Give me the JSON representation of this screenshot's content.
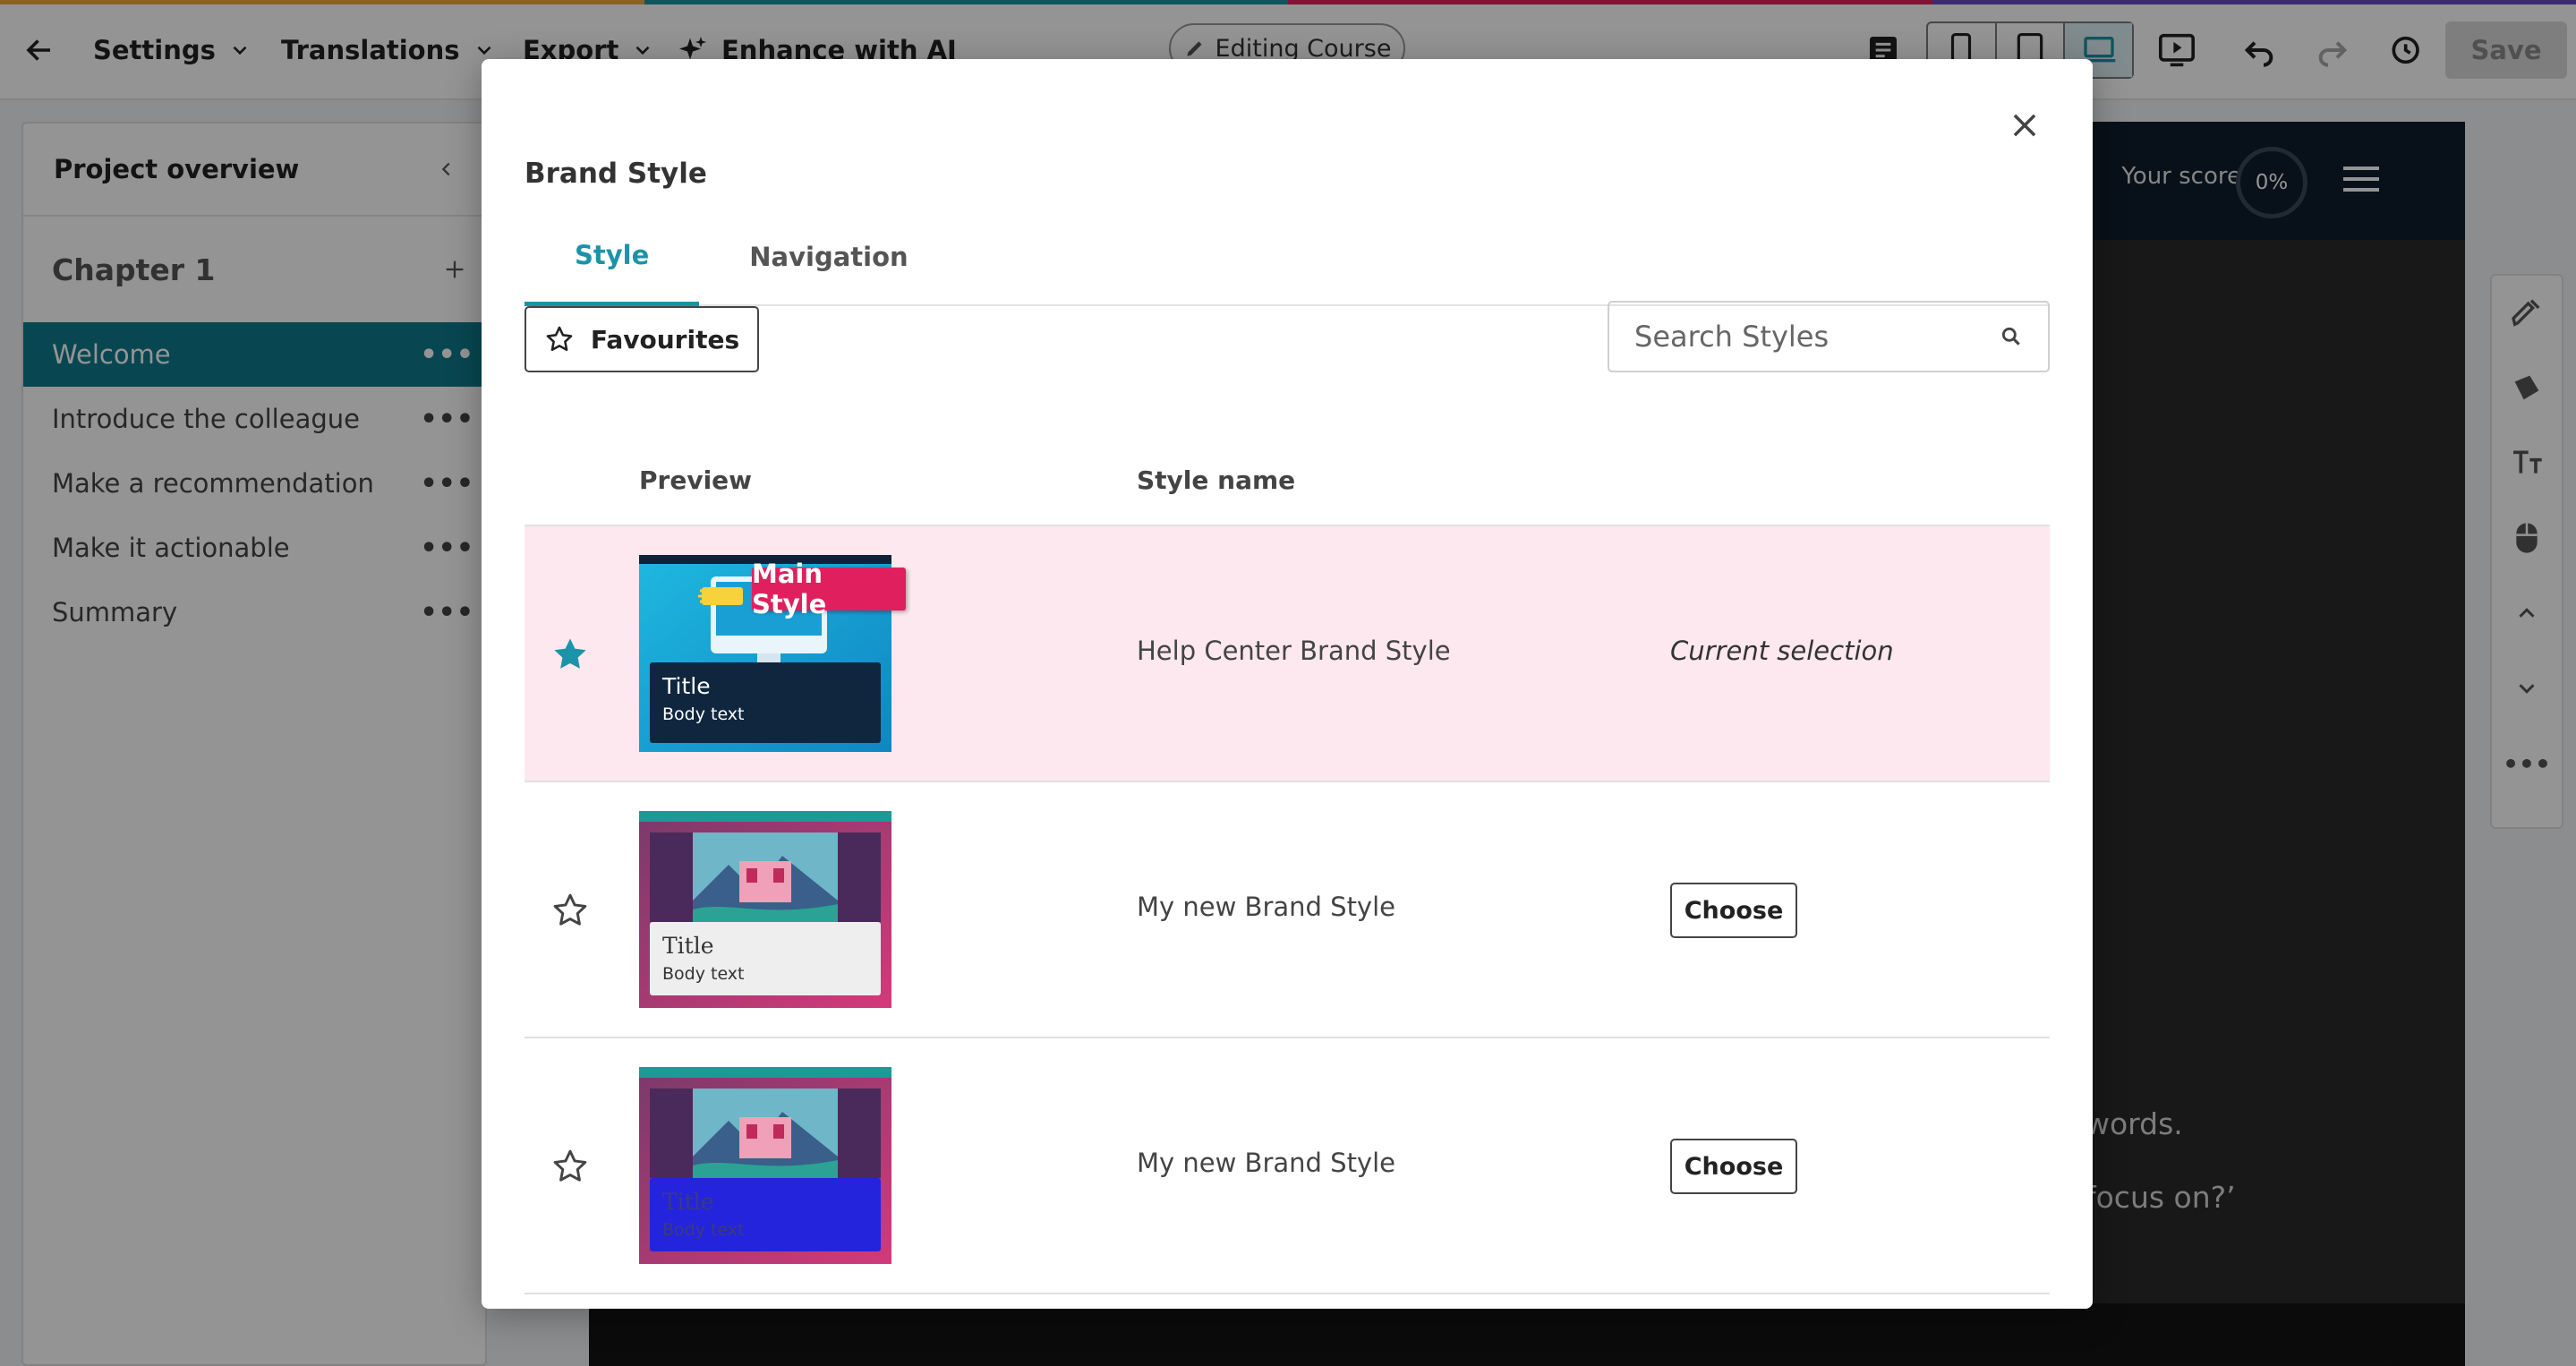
{
  "colors": {
    "accent": "#1b93a8",
    "sidebar_active": "#0e7a8e",
    "current_row_bg": "#fce8ee",
    "badge": "#e0205e"
  },
  "toolbar": {
    "back_icon": "arrow-left-icon",
    "menus": [
      {
        "label": "Settings"
      },
      {
        "label": "Translations"
      },
      {
        "label": "Export"
      }
    ],
    "ai_label": "Enhance with AI",
    "editing_label": "Editing Course",
    "save_label": "Save"
  },
  "sidebar": {
    "title": "Project overview",
    "chapter": "Chapter 1",
    "pages": [
      {
        "label": "Welcome",
        "active": true
      },
      {
        "label": "Introduce the colleague"
      },
      {
        "label": "Make a recommendation"
      },
      {
        "label": "Make it actionable"
      },
      {
        "label": "Summary"
      }
    ]
  },
  "stage": {
    "score_label": "Your score",
    "score_value": "0%",
    "text_line1": "words.",
    "text_line2": "focus on?’"
  },
  "modal": {
    "title": "Brand Style",
    "tabs": [
      {
        "label": "Style",
        "active": true
      },
      {
        "label": "Navigation"
      }
    ],
    "favourites_label": "Favourites",
    "search": {
      "placeholder": "Search Styles"
    },
    "columns": {
      "preview": "Preview",
      "style_name": "Style name"
    },
    "rows": [
      {
        "favourite": true,
        "name": "Help Center Brand Style",
        "status": "Current selection",
        "preview": {
          "badge": "Main Style",
          "title": "Title",
          "body": "Body text"
        }
      },
      {
        "favourite": false,
        "name": "My new Brand Style",
        "action": "Choose",
        "preview": {
          "title": "Title",
          "body": "Body text"
        }
      },
      {
        "favourite": false,
        "name": "My new Brand Style",
        "action": "Choose",
        "preview": {
          "title": "Title",
          "body": "Body text"
        }
      }
    ]
  }
}
